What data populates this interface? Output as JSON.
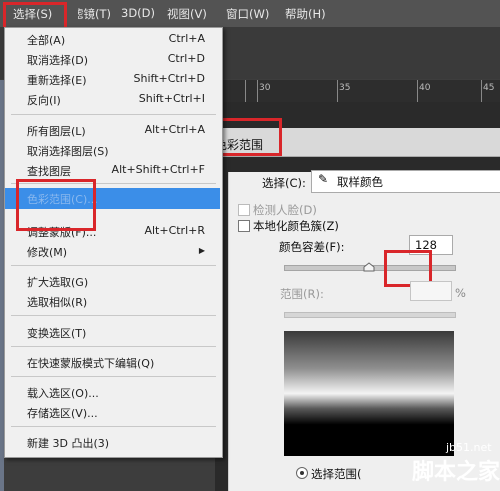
{
  "menubar": {
    "items": [
      {
        "label": "选择(S)"
      },
      {
        "label": "滤镜(T)"
      },
      {
        "label": "3D(D)"
      },
      {
        "label": "视图(V)"
      },
      {
        "label": "窗口(W)"
      },
      {
        "label": "帮助(H)"
      }
    ]
  },
  "ruler": {
    "labels": [
      "30",
      "35",
      "40",
      "45"
    ]
  },
  "select_menu": {
    "items": [
      {
        "label": "全部(A)",
        "shortcut": "Ctrl+A"
      },
      {
        "label": "取消选择(D)",
        "shortcut": "Ctrl+D"
      },
      {
        "label": "重新选择(E)",
        "shortcut": "Shift+Ctrl+D"
      },
      {
        "label": "反向(I)",
        "shortcut": "Shift+Ctrl+I"
      },
      {
        "label": "所有图层(L)",
        "shortcut": "Alt+Ctrl+A"
      },
      {
        "label": "取消选择图层(S)",
        "shortcut": ""
      },
      {
        "label": "查找图层",
        "shortcut": "Alt+Shift+Ctrl+F"
      },
      {
        "label": "色彩范围(C)...",
        "shortcut": ""
      },
      {
        "label": "调整蒙版(F)...",
        "shortcut": "Alt+Ctrl+R"
      },
      {
        "label": "修改(M)",
        "shortcut": ""
      },
      {
        "label": "扩大选取(G)",
        "shortcut": ""
      },
      {
        "label": "选取相似(R)",
        "shortcut": ""
      },
      {
        "label": "变换选区(T)",
        "shortcut": ""
      },
      {
        "label": "在快速蒙版模式下编辑(Q)",
        "shortcut": ""
      },
      {
        "label": "载入选区(O)...",
        "shortcut": ""
      },
      {
        "label": "存储选区(V)...",
        "shortcut": ""
      },
      {
        "label": "新建 3D 凸出(3)",
        "shortcut": ""
      }
    ]
  },
  "dialog": {
    "title": "色彩范围",
    "select_label": "选择(C):",
    "select_value": "取样颜色",
    "detect_faces": "检测人脸(D)",
    "localized": "本地化颜色簇(Z)",
    "fuzziness_label": "颜色容差(F):",
    "fuzziness_value": "128",
    "fuzziness_level": 0.5,
    "range_label": "范围(R):",
    "range_unit": "%",
    "radio_label": "选择范围("
  },
  "watermark": {
    "site": "jb51.net",
    "name": "脚本之家"
  },
  "colors": {
    "highlight": "#3b8ee8",
    "annotation": "#d9262a",
    "menubar": "#535353"
  }
}
